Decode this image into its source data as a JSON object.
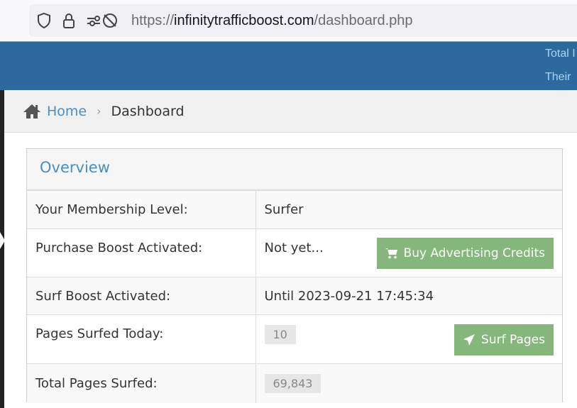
{
  "browser": {
    "url_scheme": "https://",
    "url_domain": "infinitytrafficboost.com",
    "url_path": "/dashboard.php"
  },
  "topbar": {
    "line1": "Total I",
    "line2": "Their"
  },
  "breadcrumb": {
    "home": "Home",
    "current": "Dashboard"
  },
  "overview": {
    "title": "Overview",
    "rows": [
      {
        "label": "Your Membership Level:",
        "value": "Surfer"
      },
      {
        "label": "Purchase Boost Activated:",
        "value": "Not yet...",
        "button": "Buy Advertising Credits"
      },
      {
        "label": "Surf Boost Activated:",
        "value": "Until 2023-09-21 17:45:34"
      },
      {
        "label": "Pages Surfed Today:",
        "value": "10",
        "button": "Surf Pages"
      },
      {
        "label": "Total Pages Surfed:",
        "value": "69,843"
      }
    ]
  }
}
